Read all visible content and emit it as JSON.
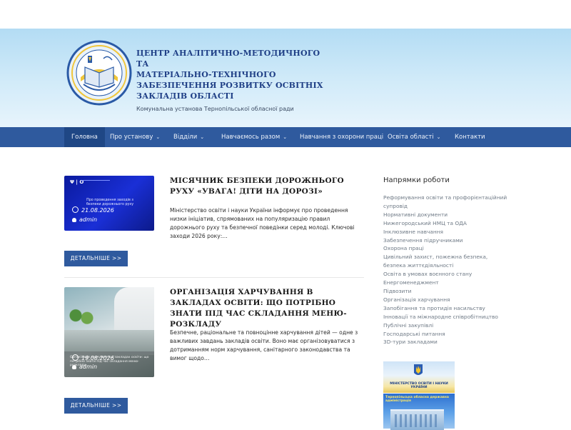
{
  "header": {
    "title_lines": [
      "ЦЕНТР АНАЛІТИЧНО-МЕТОДИЧНОГО ТА",
      "МАТЕРІАЛЬНО-ТЕХНІЧНОГО",
      "ЗАБЕЗПЕЧЕННЯ РОЗВИТКУ ОСВІТНІХ",
      "ЗАКЛАДІВ ОБЛАСТІ"
    ],
    "subtitle": "Комунальна установа Тернопільської обласної ради",
    "logo_icon": "center-emblem-icon"
  },
  "nav": {
    "items": [
      {
        "label": "Головна",
        "dropdown": false,
        "active": true
      },
      {
        "label": "Про установу",
        "dropdown": true
      },
      {
        "label": "Відділи",
        "dropdown": true
      },
      {
        "label": "Навчаємось разом",
        "dropdown": true
      },
      {
        "label": "Навчання з охорони праці",
        "dropdown": false
      },
      {
        "label": "Освіта області",
        "dropdown": true
      },
      {
        "label": "Контакти",
        "dropdown": false
      }
    ]
  },
  "posts": [
    {
      "title": "МІСЯЧНИК БЕЗПЕКИ ДОРОЖНЬОГО РУХУ «УВАГА! ДІТИ НА ДОРОЗІ»",
      "excerpt": "Міністерство освіти і науки України інформує про проведення низки ініціатив, спрямованих на популяризацію правил дорожнього руху та безпечної поведінки серед молоді. Ключові заходи 2026 року:…",
      "date": "21.08.2026",
      "author": "admin",
      "thumb_caption": "Про проведення заходів з безпеки дорожнього руху",
      "more_label": "ДЕТАЛЬНІШЕ >>"
    },
    {
      "title": "ОРГАНІЗАЦІЯ ХАРЧУВАННЯ В ЗАКЛАДАХ ОСВІТИ: ЩО ПОТРІБНО ЗНАТИ ПІД ЧАС СКЛАДАННЯ МЕНЮ-РОЗКЛАДУ",
      "excerpt": "Безпечне, раціональне та повноцінне харчування дітей — одне з важливих завдань закладів освіти. Воно має організовуватися з дотриманням норм харчування, санітарного законодавства та вимог щодо…",
      "date": "19.08.2026",
      "author": "admin",
      "thumb_caption": "Організація харчування в закладах освіти: що потрібно знати під час складання меню-розкладу",
      "more_label": "ДЕТАЛЬНІШЕ >>"
    }
  ],
  "sidebar": {
    "title": "Напрямки роботи",
    "links": [
      "Реформування освіти та профорієнтаційний супровід",
      "Нормативні документи",
      "Нижегородський НМЦ та ОДА",
      "Інклюзивне навчання",
      "Забезпечення підручниками",
      "Охорона праці",
      "Цивільний захист, пожежна безпека, безпека життєдіяльності",
      "Освіта в умовах воєнного стану",
      "Енергоменеджмент",
      "Підвозити",
      "Організація харчування",
      "Запобігання та протидія насильству",
      "Інновації та міжнародне співробітництво",
      "Публічні закупівлі",
      "Господарські питання",
      "3D-тури закладами"
    ],
    "banner1_text": "МІНІСТЕРСТВО ОСВІТИ І НАУКИ УКРАЇНИ",
    "banner2_text": "Тернопільська обласна державна адміністрація"
  },
  "colors": {
    "nav_bg": "#2f5a9e",
    "nav_active": "#1f4785",
    "title_color": "#1f3f86",
    "button_bg": "#2f5a9e"
  }
}
